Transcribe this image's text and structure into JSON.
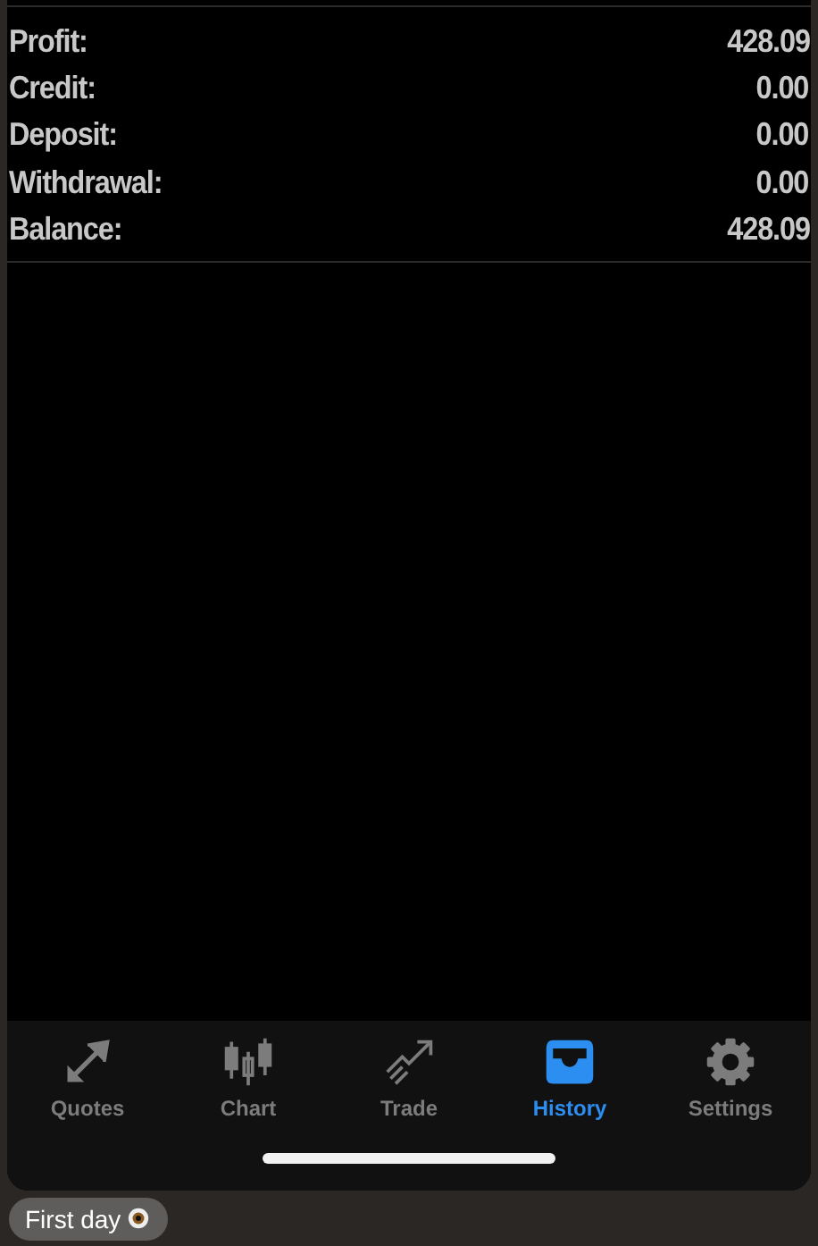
{
  "summary": [
    {
      "label": "Profit:",
      "value": "428.09"
    },
    {
      "label": "Credit:",
      "value": "0.00"
    },
    {
      "label": "Deposit:",
      "value": "0.00"
    },
    {
      "label": "Withdrawal:",
      "value": "0.00"
    },
    {
      "label": "Balance:",
      "value": "428.09"
    }
  ],
  "tabs": [
    {
      "kind": "quotes",
      "label": "Quotes",
      "selected": false
    },
    {
      "kind": "chart",
      "label": "Chart",
      "selected": false
    },
    {
      "kind": "trade",
      "label": "Trade",
      "selected": false
    },
    {
      "kind": "history",
      "label": "History",
      "selected": true
    },
    {
      "kind": "settings",
      "label": "Settings",
      "selected": false
    }
  ],
  "message": {
    "text": "First day"
  }
}
